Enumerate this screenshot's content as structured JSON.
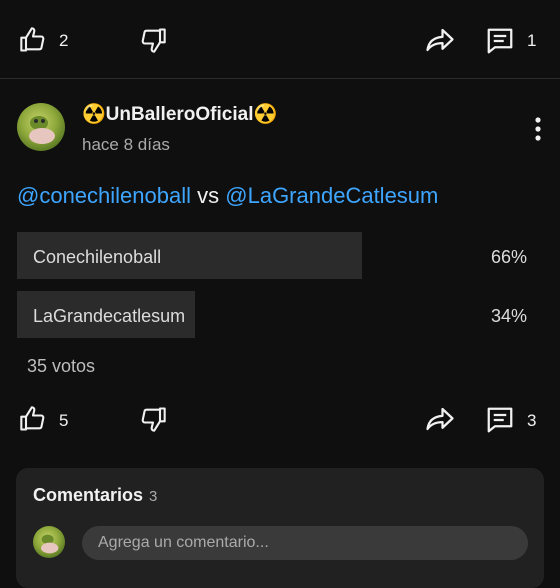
{
  "top_actions": {
    "likes": "2",
    "comments": "1"
  },
  "post": {
    "author": "☢️UnBalleroOficial☢️",
    "time_ago": "hace 8 días",
    "mention_a": "@conechilenoball",
    "vs": "vs",
    "mention_b": "@LaGrandeCatlesum"
  },
  "poll": {
    "options": [
      {
        "label": "Conechilenoball",
        "percent": "66%",
        "fraction": 0.66
      },
      {
        "label": "LaGrandecatlesum",
        "percent": "34%",
        "fraction": 0.34
      }
    ],
    "votes": "35 votos"
  },
  "bottom_actions": {
    "likes": "5",
    "comments": "3"
  },
  "comments": {
    "title": "Comentarios",
    "count": "3",
    "placeholder": "Agrega un comentario..."
  },
  "colors": {
    "background": "#0f0f0f",
    "mention": "#3ea6ff",
    "poll_bar": "#2b2b2b",
    "panel": "#212121"
  },
  "icons": [
    "like-icon",
    "dislike-icon",
    "share-icon",
    "comment-icon",
    "more-vert-icon",
    "avatar"
  ]
}
